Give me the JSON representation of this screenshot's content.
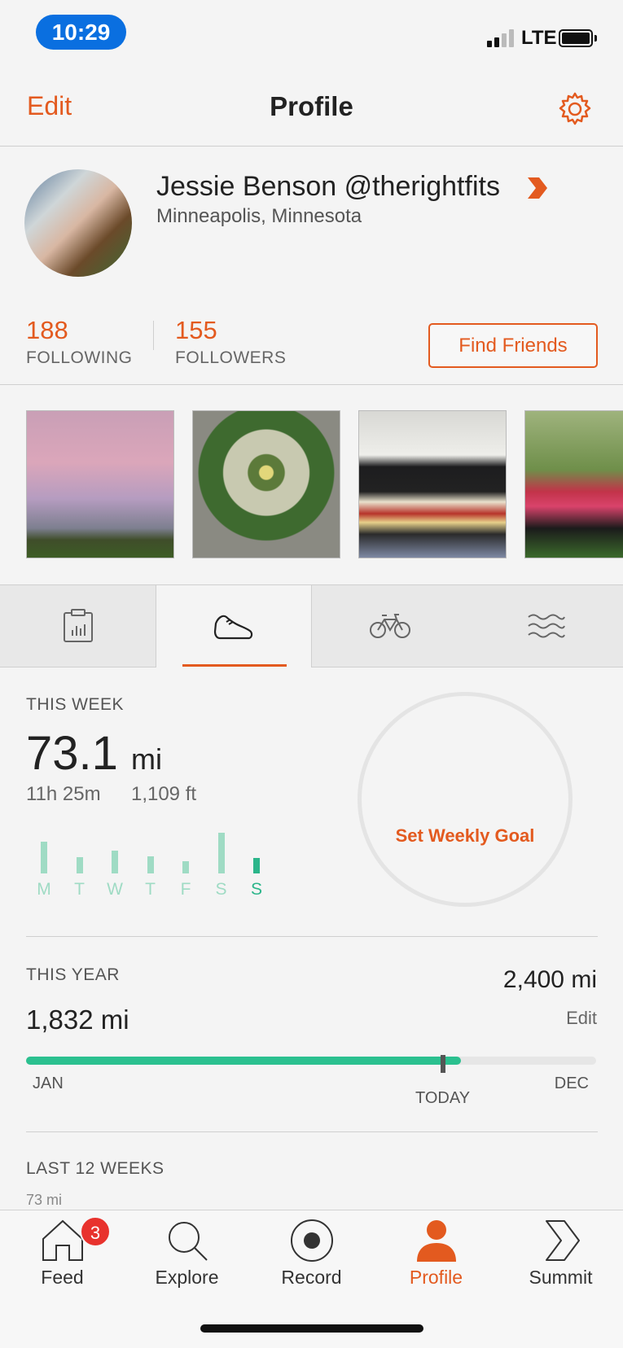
{
  "status_bar": {
    "time": "10:29",
    "network": "LTE"
  },
  "nav": {
    "edit_label": "Edit",
    "title": "Profile",
    "settings_icon": "gear-icon"
  },
  "profile": {
    "name": "Jessie Benson @therightfits",
    "location": "Minneapolis, Minnesota",
    "following_count": "188",
    "following_label": "FOLLOWING",
    "followers_count": "155",
    "followers_label": "FOLLOWERS",
    "find_friends_label": "Find Friends"
  },
  "photos": [
    "city-skyline-sunset",
    "ferris-wheel",
    "dog-on-bed",
    "runners-with-medals"
  ],
  "sport_tabs": [
    {
      "icon": "clipboard-chart-icon",
      "active": false
    },
    {
      "icon": "running-shoe-icon",
      "active": true
    },
    {
      "icon": "bicycle-icon",
      "active": false
    },
    {
      "icon": "swim-waves-icon",
      "active": false
    }
  ],
  "this_week": {
    "label": "THIS WEEK",
    "distance_value": "73.1",
    "distance_unit": "mi",
    "time": "11h 25m",
    "elevation": "1,109 ft",
    "days": [
      "M",
      "T",
      "W",
      "T",
      "F",
      "S",
      "S"
    ],
    "day_bars": [
      0.78,
      0.4,
      0.55,
      0.42,
      0.3,
      1.0,
      0.38
    ],
    "today_index": 6,
    "goal_label": "Set Weekly Goal"
  },
  "this_year": {
    "label": "THIS YEAR",
    "distance": "1,832 mi",
    "goal": "2,400 mi",
    "edit_label": "Edit",
    "progress": 0.763,
    "start_label": "JAN",
    "end_label": "DEC",
    "today_label": "TODAY"
  },
  "last_12_weeks": {
    "label": "LAST 12 WEEKS",
    "max_value": "73 mi"
  },
  "bottom_tabs": [
    {
      "label": "Feed",
      "icon": "home-icon",
      "badge": "3",
      "active": false
    },
    {
      "label": "Explore",
      "icon": "search-icon",
      "active": false
    },
    {
      "label": "Record",
      "icon": "record-icon",
      "active": false
    },
    {
      "label": "Profile",
      "icon": "person-icon",
      "active": true
    },
    {
      "label": "Summit",
      "icon": "summit-chevron-icon",
      "active": false
    }
  ],
  "colors": {
    "accent": "#e35a1f",
    "progress": "#2bc08f",
    "status_pill": "#0a6fe0",
    "badge": "#e8322d"
  }
}
